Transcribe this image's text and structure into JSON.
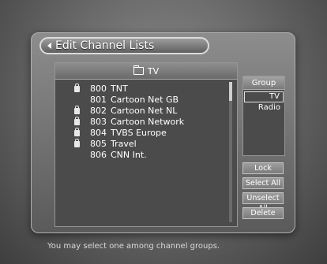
{
  "title": "Edit Channel Lists",
  "list": {
    "header": "TV",
    "channels": [
      {
        "locked": true,
        "number": "800",
        "name": "TNT"
      },
      {
        "locked": false,
        "number": "801",
        "name": "Cartoon Net GB"
      },
      {
        "locked": true,
        "number": "802",
        "name": "Cartoon Net NL"
      },
      {
        "locked": true,
        "number": "803",
        "name": "Cartoon Network"
      },
      {
        "locked": true,
        "number": "804",
        "name": "TVBS Europe"
      },
      {
        "locked": true,
        "number": "805",
        "name": "Travel"
      },
      {
        "locked": false,
        "number": "806",
        "name": "CNN Int."
      }
    ]
  },
  "group": {
    "label": "Group",
    "items": [
      {
        "label": "TV",
        "selected": true
      },
      {
        "label": "Radio",
        "selected": false
      }
    ]
  },
  "buttons": {
    "lock": "Lock",
    "select_all": "Select All",
    "unselect_all": "Unselect All",
    "delete": "Delete"
  },
  "hint": "You may select one among channel groups."
}
